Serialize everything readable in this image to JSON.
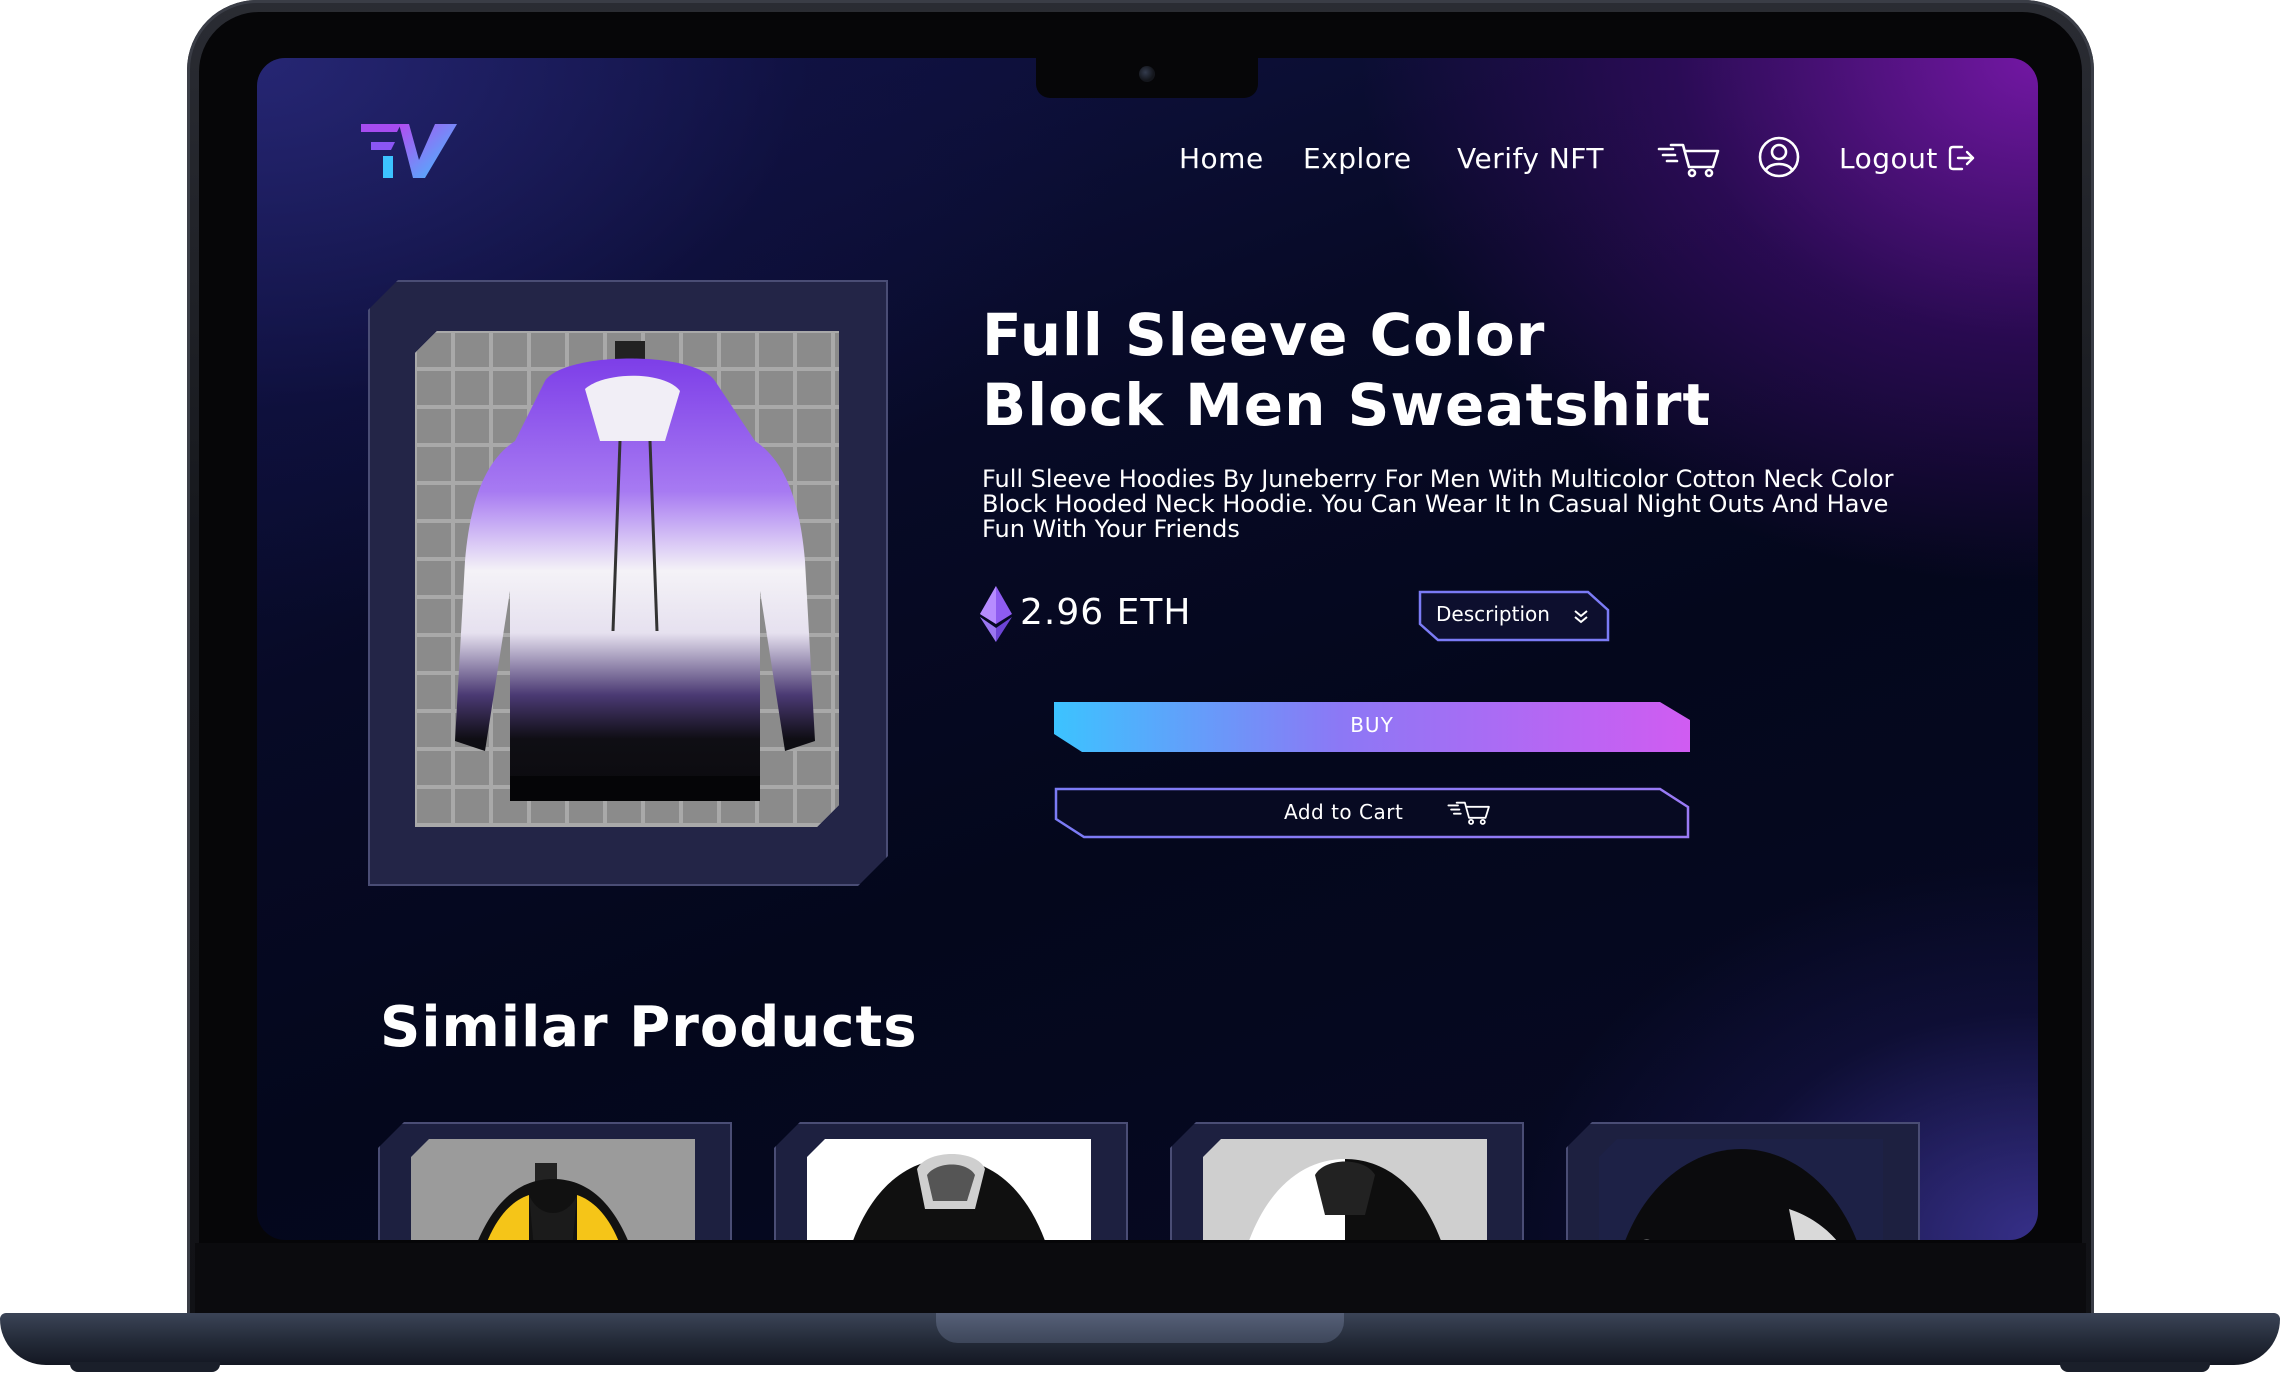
{
  "nav": {
    "home": "Home",
    "explore": "Explore",
    "verify": "Verify NFT",
    "cart_icon": "cart-icon",
    "user_icon": "user-icon",
    "logout": "Logout",
    "logout_icon": "logout-icon"
  },
  "product": {
    "title_line1": "Full Sleeve Color",
    "title_line2": "Block Men Sweatshirt",
    "description": "Full Sleeve Hoodies By Juneberry For Men With Multicolor Cotton Neck Color Block Hooded Neck Hoodie. You Can Wear It In Casual Night Outs And Have Fun With Your Friends",
    "price": "2.96 ETH",
    "currency_icon": "ethereum-icon",
    "description_button": "Description",
    "buy_button": "BUY",
    "cart_button": "Add to Cart"
  },
  "similar": {
    "title": "Similar Products",
    "items": [
      {
        "name": "yellow-black-hoodie"
      },
      {
        "name": "black-white-print-hoodie"
      },
      {
        "name": "black-white-colorblock-hoodie"
      },
      {
        "name": "black-printed-hoodie"
      }
    ]
  },
  "colors": {
    "accent_cyan": "#3cc3ff",
    "accent_purple": "#c95cf0",
    "button_border": "#7b7bf5"
  }
}
